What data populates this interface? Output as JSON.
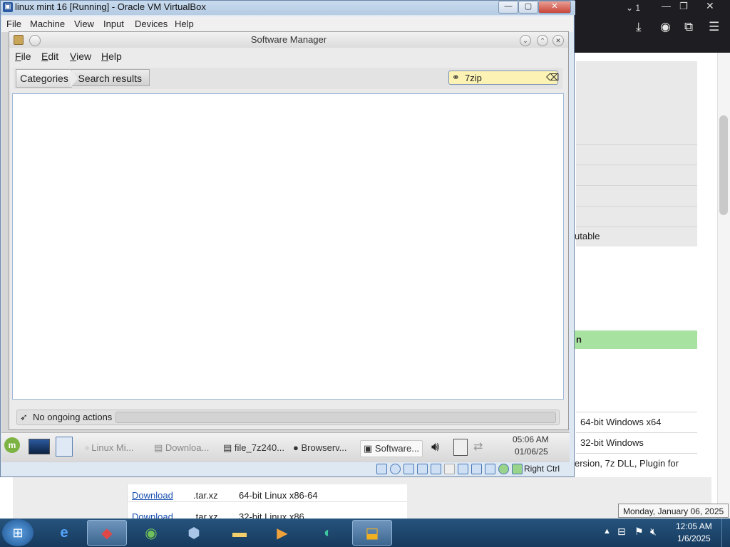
{
  "vbox": {
    "title": "linux mint 16 [Running] - Oracle VM VirtualBox",
    "menu": [
      "File",
      "Machine",
      "View",
      "Input",
      "Devices",
      "Help"
    ],
    "host_key": "Right Ctrl"
  },
  "browser_bg": {
    "tab_count": "1",
    "row_texts": [
      "utable"
    ],
    "green_header": "n",
    "desc_rows": [
      "64-bit Windows x64",
      "32-bit Windows",
      "ersion, 7z DLL, Plugin for"
    ],
    "table_rows": [
      {
        "link": "Download",
        "ext": ".tar.xz",
        "desc": "64-bit Linux x86-64"
      },
      {
        "link": "Download",
        "ext": ".tar.xz",
        "desc": "32-bit Linux x86"
      }
    ]
  },
  "software_manager": {
    "title": "Software Manager",
    "menu": [
      {
        "label": "File",
        "accel": "F",
        "rest": "ile"
      },
      {
        "label": "Edit",
        "accel": "E",
        "rest": "dit"
      },
      {
        "label": "View",
        "accel": "V",
        "rest": "iew"
      },
      {
        "label": "Help",
        "accel": "H",
        "rest": "elp"
      }
    ],
    "breadcrumbs": [
      "Categories",
      "Search results"
    ],
    "search_value": "7zip",
    "status_text": "No ongoing actions"
  },
  "mint_panel": {
    "tasks": [
      "Linux Mi...",
      "Downloa...",
      "file_7z240...",
      "Browserv...",
      "Software..."
    ],
    "clock_time": "05:06 AM",
    "clock_date": "01/06/25"
  },
  "windows": {
    "tray_time": "12:05 AM",
    "tray_date": "1/6/2025",
    "tooltip": "Monday, January 06, 2025"
  },
  "colors": {
    "search_highlight": "#fbf2b4",
    "taskbar": "#1e4770",
    "green_band": "#a8e2a0"
  }
}
